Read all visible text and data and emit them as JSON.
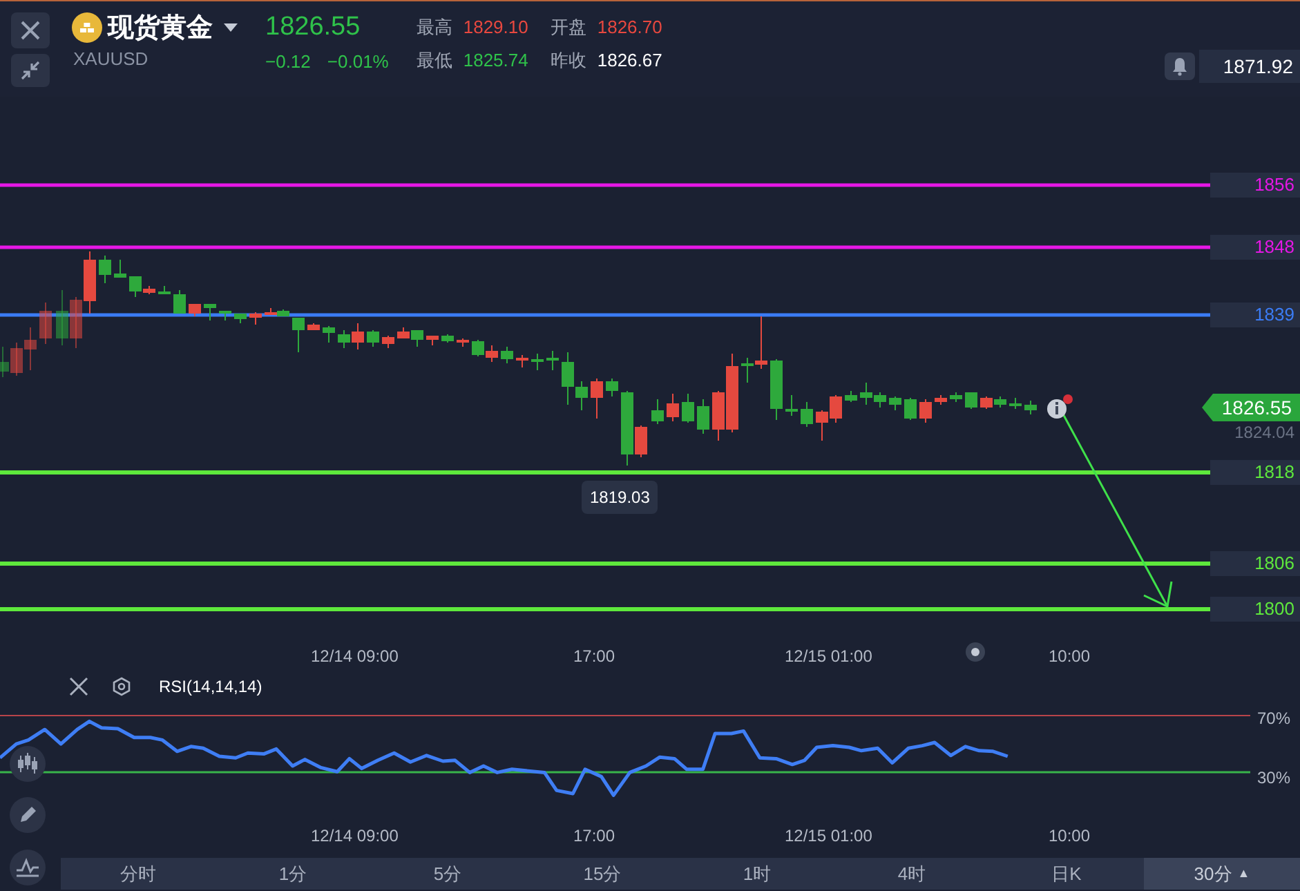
{
  "header": {
    "name": "现货黄金",
    "code": "XAUUSD",
    "price": "1826.55",
    "change": "−0.12",
    "change_pct": "−0.01%",
    "stats": [
      {
        "label": "最高",
        "value": "1829.10",
        "color": "#e8483f"
      },
      {
        "label": "开盘",
        "value": "1826.70",
        "color": "#e8483f"
      },
      {
        "label": "最低",
        "value": "1825.74",
        "color": "#2fc24a"
      },
      {
        "label": "昨收",
        "value": "1826.67",
        "color": "#ffffff"
      }
    ]
  },
  "alert_price": "1871.92",
  "price_lines": [
    {
      "label": "1856",
      "color": "#e617e6",
      "kind": "thin"
    },
    {
      "label": "1848",
      "color": "#e617e6",
      "kind": "thin"
    },
    {
      "label": "1839",
      "color": "#3b7cf5",
      "kind": "thin"
    },
    {
      "label": "1818",
      "color": "#5ee83c",
      "kind": "thick"
    },
    {
      "label": "1806",
      "color": "#5ee83c",
      "kind": "thick"
    },
    {
      "label": "1800",
      "color": "#5ee83c",
      "kind": "thick"
    }
  ],
  "current_price": {
    "value": "1826.55",
    "secondary": "1824.04"
  },
  "low_marker": "1819.03",
  "time_axis": [
    "12/14 09:00",
    "17:00",
    "12/15 01:00",
    "10:00"
  ],
  "rsi": {
    "title": "RSI(14,14,14)",
    "upper": "70%",
    "lower": "30%",
    "time_axis": [
      "12/14 09:00",
      "17:00",
      "12/15 01:00",
      "10:00"
    ]
  },
  "timeframes": [
    {
      "label": "分时",
      "selected": false
    },
    {
      "label": "1分",
      "selected": false
    },
    {
      "label": "5分",
      "selected": false
    },
    {
      "label": "15分",
      "selected": false
    },
    {
      "label": "1时",
      "selected": false
    },
    {
      "label": "4时",
      "selected": false
    },
    {
      "label": "日K",
      "selected": false
    },
    {
      "label": "30分",
      "selected": true,
      "caret": "▲"
    }
  ]
}
